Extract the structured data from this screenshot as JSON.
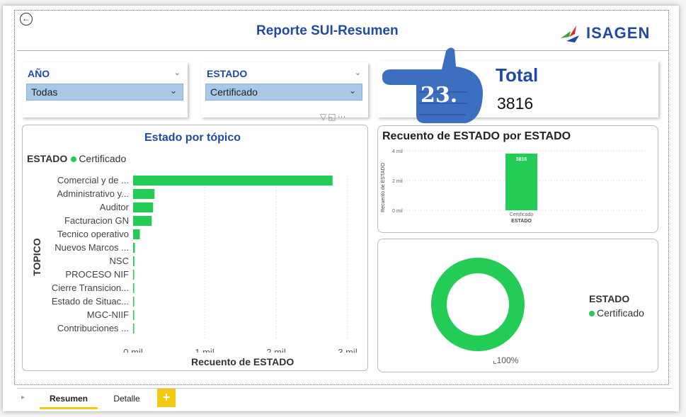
{
  "header": {
    "back_icon": "back-arrow-circle-icon",
    "title": "Reporte SUI-Resumen",
    "logo_text": "ISAGEN"
  },
  "slicers": [
    {
      "title": "AÑO",
      "value": "Todas"
    },
    {
      "title": "ESTADO",
      "value": "Certificado"
    }
  ],
  "total_card": {
    "label": "Total",
    "value": "3816"
  },
  "step_callout": {
    "number": "23.",
    "icon": "pointing-hand-icon",
    "color": "#3d6fc0"
  },
  "visual_toolbar": {
    "icons": [
      "filter-icon",
      "focus-mode-icon",
      "more-options-icon"
    ]
  },
  "bar_panel": {
    "title": "Estado por tópico",
    "legend_title": "ESTADO",
    "legend_item": "Certificado",
    "ylabel": "TOPICO",
    "xlabel": "Recuento de ESTADO"
  },
  "count_panel": {
    "title": "Recuento de ESTADO por ESTADO",
    "ylabel": "Recuento de ESTADO",
    "xlabel": "ESTADO"
  },
  "donut_panel": {
    "legend_title": "ESTADO",
    "legend_item": "Certificado",
    "percent_label": "100%"
  },
  "tabs": {
    "items": [
      "Resumen",
      "Detalle"
    ],
    "active": "Resumen",
    "add_label": "+"
  },
  "colors": {
    "accent_blue": "#1f4aa8",
    "series_green": "#22cc55",
    "tab_yellow": "#f2c811",
    "slicer_blue": "#a8c8e8"
  },
  "chart_data": [
    {
      "type": "bar",
      "orientation": "horizontal",
      "title": "Estado por tópico",
      "xlabel": "Recuento de ESTADO",
      "ylabel": "TOPICO",
      "categories": [
        "Comercial y de ...",
        "Administrativo y...",
        "Auditor",
        "Facturacion GN",
        "Tecnico operativo",
        "Nuevos Marcos ...",
        "NSC",
        "PROCESO NIF",
        "Cierre Transicion...",
        "Estado de Situac...",
        "MGC-NIIF",
        "Contribuciones ..."
      ],
      "series": [
        {
          "name": "Certificado",
          "values": [
            2790,
            300,
            280,
            260,
            95,
            25,
            18,
            12,
            10,
            8,
            6,
            4
          ]
        }
      ],
      "xticks": [
        "0 mil",
        "1 mil",
        "2 mil",
        "3 mil"
      ],
      "xlim": [
        0,
        3000
      ],
      "grid": true
    },
    {
      "type": "bar",
      "title": "Recuento de ESTADO por ESTADO",
      "xlabel": "ESTADO",
      "ylabel": "Recuento de ESTADO",
      "categories": [
        "Certificado"
      ],
      "values": [
        3816
      ],
      "data_labels": [
        "3816"
      ],
      "yticks": [
        "0 mil",
        "2 mil",
        "4 mil"
      ],
      "ylim": [
        0,
        4000
      ]
    },
    {
      "type": "pie",
      "style": "donut",
      "categories": [
        "Certificado"
      ],
      "values": [
        100
      ],
      "data_labels": [
        "100%"
      ],
      "legend_title": "ESTADO",
      "legend_position": "right"
    }
  ]
}
